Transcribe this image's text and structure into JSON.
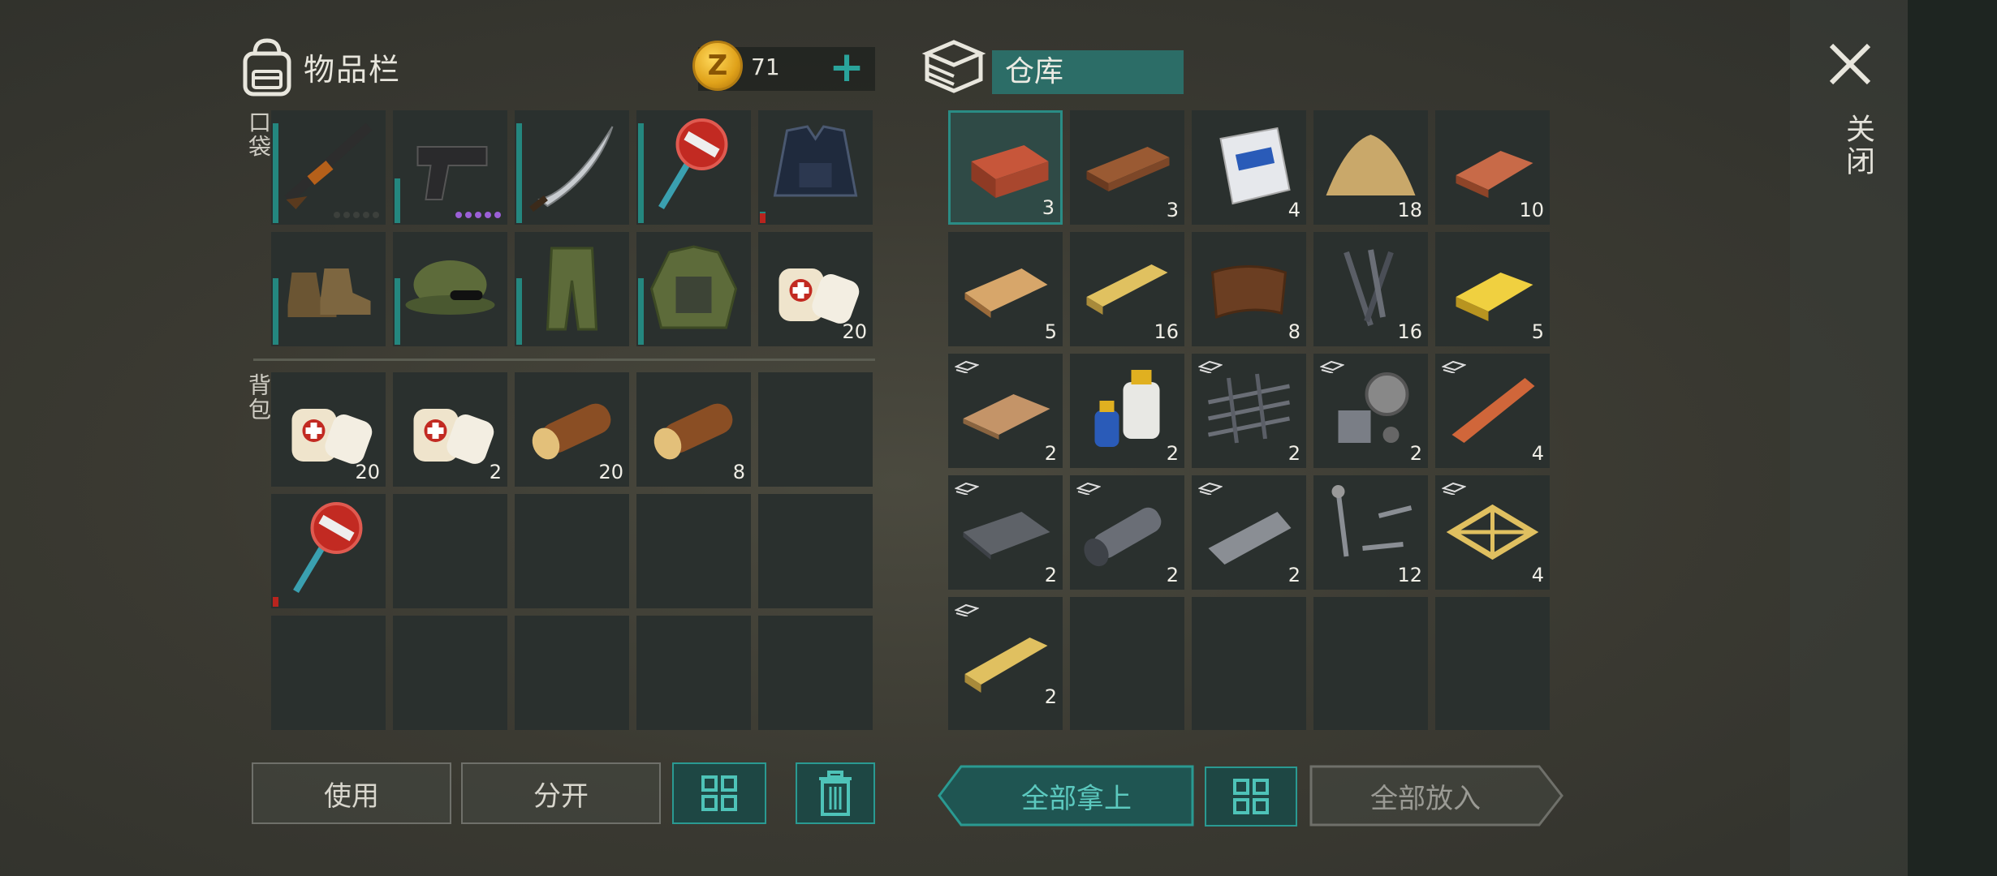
{
  "inventory": {
    "title": "物品栏",
    "coins": "71",
    "coin_symbol": "Z",
    "pocket_label": "口袋",
    "backpack_label": "背包",
    "pocket_slots": [
      {
        "item": "shotgun-icon",
        "count": "",
        "durability": 0.9,
        "dots": "gray"
      },
      {
        "item": "pistol-icon",
        "count": "",
        "durability": 0.4,
        "dots": "purple"
      },
      {
        "item": "machete-icon",
        "count": "",
        "durability": 0.9,
        "dots": ""
      },
      {
        "item": "stop-sign-icon",
        "count": "",
        "durability": 0.9,
        "dots": ""
      },
      {
        "item": "police-vest-icon",
        "count": "",
        "durability": 0.1,
        "dots": "",
        "red": true
      },
      {
        "item": "boots-icon",
        "count": "",
        "durability": 0.6,
        "dots": ""
      },
      {
        "item": "camo-cap-icon",
        "count": "",
        "durability": 0.6,
        "dots": ""
      },
      {
        "item": "camo-pants-icon",
        "count": "",
        "durability": 0.6,
        "dots": ""
      },
      {
        "item": "camo-jacket-icon",
        "count": "",
        "durability": 0.6,
        "dots": ""
      },
      {
        "item": "bandage-icon",
        "count": "20",
        "durability": 0,
        "dots": ""
      }
    ],
    "backpack_slots": [
      {
        "item": "bandage-icon",
        "count": "20"
      },
      {
        "item": "bandage-icon",
        "count": "2"
      },
      {
        "item": "log-icon",
        "count": "20"
      },
      {
        "item": "log-icon",
        "count": "8"
      },
      {
        "item": "",
        "count": ""
      },
      {
        "item": "stop-sign-icon",
        "count": "",
        "red": true
      },
      {
        "item": "",
        "count": ""
      },
      {
        "item": "",
        "count": ""
      },
      {
        "item": "",
        "count": ""
      },
      {
        "item": "",
        "count": ""
      },
      {
        "item": "",
        "count": ""
      },
      {
        "item": "",
        "count": ""
      },
      {
        "item": "",
        "count": ""
      },
      {
        "item": "",
        "count": ""
      },
      {
        "item": "",
        "count": ""
      }
    ],
    "buttons": {
      "use": "使用",
      "split": "分开"
    }
  },
  "storage": {
    "title": "仓库",
    "slots": [
      {
        "item": "brick-icon",
        "count": "3",
        "selected": true
      },
      {
        "item": "plank-icon",
        "count": "3"
      },
      {
        "item": "cement-bag-icon",
        "count": "4"
      },
      {
        "item": "sand-pile-icon",
        "count": "18"
      },
      {
        "item": "copper-ingot-icon",
        "count": "10"
      },
      {
        "item": "board-icon",
        "count": "5"
      },
      {
        "item": "lumber-icon",
        "count": "16"
      },
      {
        "item": "leather-icon",
        "count": "8"
      },
      {
        "item": "nails-icon",
        "count": "16"
      },
      {
        "item": "gold-bar-icon",
        "count": "5"
      },
      {
        "item": "chipboard-icon",
        "count": "2",
        "bp": true
      },
      {
        "item": "resin-bottles-icon",
        "count": "2"
      },
      {
        "item": "rebar-mesh-icon",
        "count": "2",
        "bp": true
      },
      {
        "item": "mechanism-parts-icon",
        "count": "2",
        "bp": true
      },
      {
        "item": "copper-bar-icon",
        "count": "4",
        "bp": true
      },
      {
        "item": "metal-sheet-icon",
        "count": "2",
        "bp": true
      },
      {
        "item": "pipe-icon",
        "count": "2",
        "bp": true
      },
      {
        "item": "steel-bar-icon",
        "count": "2",
        "bp": true
      },
      {
        "item": "screws-icon",
        "count": "12"
      },
      {
        "item": "frame-icon",
        "count": "4",
        "bp": true
      },
      {
        "item": "wood-beam-icon",
        "count": "2",
        "bp": true
      },
      {
        "item": "",
        "count": ""
      },
      {
        "item": "",
        "count": ""
      },
      {
        "item": "",
        "count": ""
      },
      {
        "item": "",
        "count": ""
      }
    ],
    "buttons": {
      "take_all": "全部拿上",
      "put_all": "全部放入"
    }
  },
  "close_label": "关闭",
  "colors": {
    "accent": "#2aa39b",
    "durability": "#24877f",
    "warning": "#b8241e"
  }
}
